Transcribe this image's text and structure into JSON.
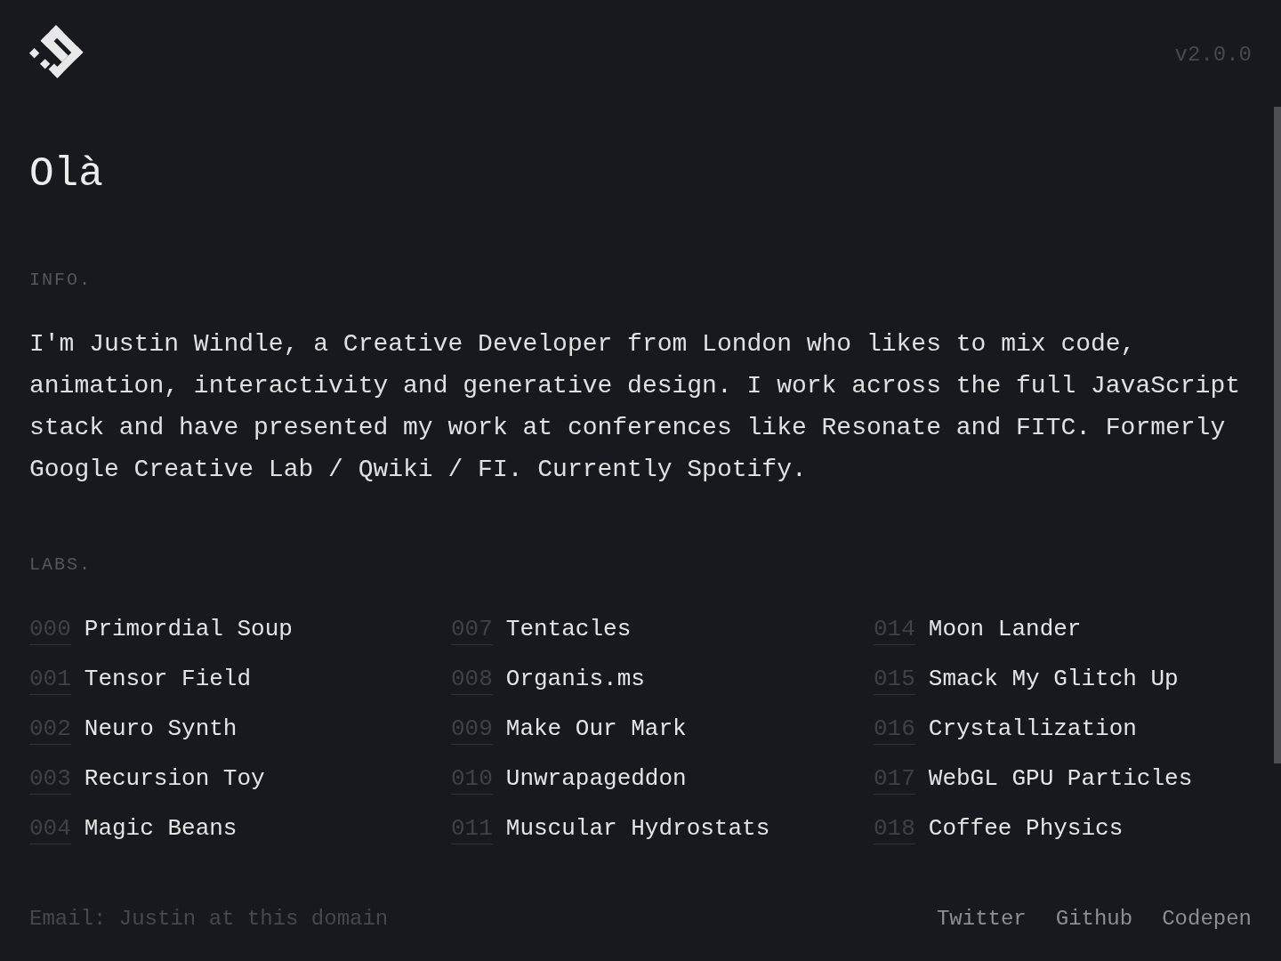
{
  "header": {
    "version": "v2.0.0"
  },
  "greeting": "Olà",
  "info": {
    "label": "INFO.",
    "text": "I'm Justin Windle, a Creative Developer from London who likes to mix code, animation, interactivity and generative design. I work across the full JavaScript stack and have presented my work at conferences like Resonate and FITC. Formerly Google Creative Lab / Qwiki / FI. Currently Spotify."
  },
  "labs": {
    "label": "LABS.",
    "items": [
      {
        "number": "000",
        "title": "Primordial Soup"
      },
      {
        "number": "001",
        "title": "Tensor Field"
      },
      {
        "number": "002",
        "title": "Neuro Synth"
      },
      {
        "number": "003",
        "title": "Recursion Toy"
      },
      {
        "number": "004",
        "title": "Magic Beans"
      },
      {
        "number": "007",
        "title": "Tentacles"
      },
      {
        "number": "008",
        "title": "Organis.ms"
      },
      {
        "number": "009",
        "title": "Make Our Mark"
      },
      {
        "number": "010",
        "title": "Unwrapageddon"
      },
      {
        "number": "011",
        "title": "Muscular Hydrostats"
      },
      {
        "number": "014",
        "title": "Moon Lander"
      },
      {
        "number": "015",
        "title": "Smack My Glitch Up"
      },
      {
        "number": "016",
        "title": "Crystallization"
      },
      {
        "number": "017",
        "title": "WebGL GPU Particles"
      },
      {
        "number": "018",
        "title": "Coffee Physics"
      }
    ]
  },
  "footer": {
    "email": "Email: Justin at this domain",
    "links": [
      "Twitter",
      "Github",
      "Codepen"
    ]
  }
}
